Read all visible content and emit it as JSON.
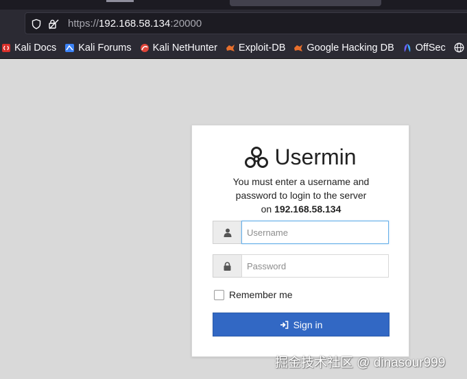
{
  "browser": {
    "url_scheme": "https://",
    "url_host": "192.168.58.134",
    "url_port": ":20000",
    "bookmarks": [
      {
        "label": "Kali Docs",
        "icon": "kali-docs-icon",
        "color": "#d9302b"
      },
      {
        "label": "Kali Forums",
        "icon": "kali-forums-icon",
        "color": "#3b82f6"
      },
      {
        "label": "Kali NetHunter",
        "icon": "kali-nethunter-icon",
        "color": "#e0463a"
      },
      {
        "label": "Exploit-DB",
        "icon": "exploit-db-icon",
        "color": "#e76f2c"
      },
      {
        "label": "Google Hacking DB",
        "icon": "ghdb-icon",
        "color": "#e76f2c"
      },
      {
        "label": "OffSec",
        "icon": "offsec-icon",
        "color": "#6c63ff"
      }
    ]
  },
  "login": {
    "brand": "Usermin",
    "message_line1": "You must enter a username and",
    "message_line2": "password to login to the server",
    "message_on": "on",
    "host": "192.168.58.134",
    "username_placeholder": "Username",
    "password_placeholder": "Password",
    "remember_label": "Remember me",
    "signin_label": "Sign in",
    "accent_color": "#3268c4"
  },
  "watermark": "掘金技术社区 @ dinasour999"
}
